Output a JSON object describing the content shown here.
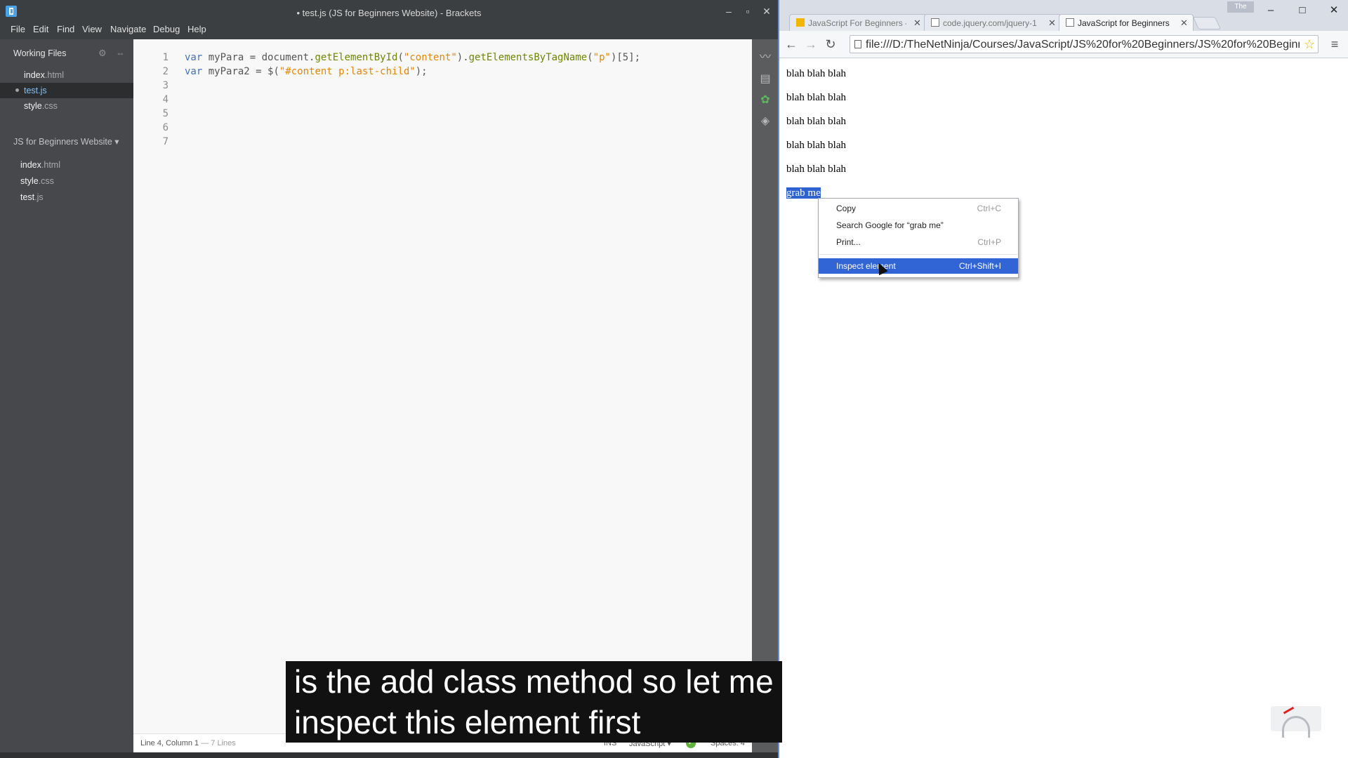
{
  "brackets": {
    "title": "• test.js (JS for Beginners Website) - Brackets",
    "menu": [
      "File",
      "Edit",
      "Find",
      "View",
      "Navigate",
      "Debug",
      "Help"
    ],
    "sidebar": {
      "working_files_header": "Working Files",
      "working_files": [
        {
          "name": "index",
          "ext": ".html"
        },
        {
          "name": "test",
          "ext": ".js"
        },
        {
          "name": "style",
          "ext": ".css"
        }
      ],
      "project_header": "JS for Beginners Website ▾",
      "project_files": [
        {
          "name": "index",
          "ext": ".html"
        },
        {
          "name": "style",
          "ext": ".css"
        },
        {
          "name": "test",
          "ext": ".js"
        }
      ]
    },
    "editor": {
      "line_numbers": [
        "1",
        "2",
        "3",
        "4",
        "5",
        "6",
        "7"
      ],
      "line1": {
        "a": "var",
        "b": " myPara = document.",
        "c": "getElementById",
        "d": "(",
        "e": "\"content\"",
        "f": ").",
        "g": "getElementsByTagName",
        "h": "(",
        "i": "\"p\"",
        "j": ")[5];"
      },
      "line2": {
        "a": "var",
        "b": " myPara2 = $(",
        "c": "\"#content p:last-child\"",
        "d": ");"
      }
    },
    "statusbar": {
      "position": "Line 4, Column 1",
      "lines": " — 7 Lines",
      "mode": "INS",
      "language": "JavaScript ▾",
      "spaces": "Spaces: 4"
    }
  },
  "chrome": {
    "tabs": [
      {
        "label": "JavaScript For Beginners -"
      },
      {
        "label": "code.jquery.com/jquery-1"
      },
      {
        "label": "JavaScript for Beginners"
      }
    ],
    "person_label": "The",
    "url": "file:///D:/TheNetNinja/Courses/JavaScript/JS%20for%20Beginners/JS%20for%20Beginners",
    "page_paragraphs": [
      "blah blah blah",
      "blah blah blah",
      "blah blah blah",
      "blah blah blah",
      "blah blah blah"
    ],
    "selected_text": "grab me",
    "context_menu": [
      {
        "label": "Copy",
        "shortcut": "Ctrl+C"
      },
      {
        "label": "Search Google for “grab me”",
        "shortcut": ""
      },
      {
        "label": "Print...",
        "shortcut": "Ctrl+P"
      },
      {
        "label": "Inspect element",
        "shortcut": "Ctrl+Shift+I"
      }
    ]
  },
  "subtitle": {
    "line1": "is the add class method so let me",
    "line2": "inspect this element first"
  },
  "colors": {
    "selection": "#2d62d0",
    "menu_highlight": "#3165d6",
    "brackets_sidebar": "#47484b",
    "editor_bg": "#f8f8f8"
  }
}
